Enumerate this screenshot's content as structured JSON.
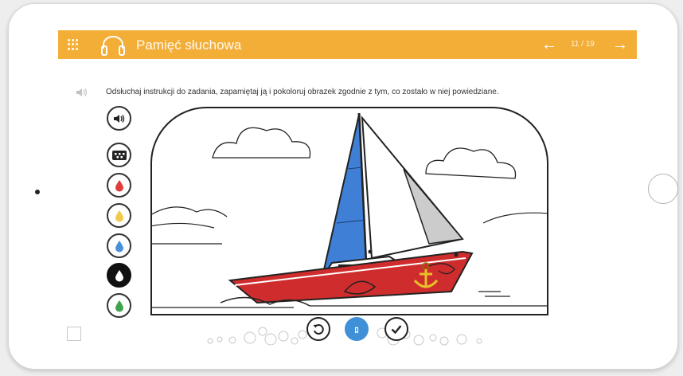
{
  "app": {
    "title": "Pamięć słuchowa",
    "accent_color": "#f3ae37"
  },
  "nav": {
    "counter": "11 / 19",
    "prev_icon": "arrow-left-icon",
    "next_icon": "arrow-right-icon"
  },
  "task": {
    "instruction": "Odsłuchaj instrukcji do zadania, zapamiętaj ją i pokoloruj obrazek zgodnie z tym, co zostało w niej powiedziane."
  },
  "tools": [
    {
      "name": "speaker",
      "icon": "speaker-icon"
    },
    {
      "name": "eraser",
      "icon": "eraser-icon"
    },
    {
      "name": "red",
      "icon": "drop-icon",
      "color": "#e03c3c"
    },
    {
      "name": "yellow",
      "icon": "drop-icon",
      "color": "#f2c94c"
    },
    {
      "name": "blue",
      "icon": "drop-icon",
      "color": "#4a90d9"
    },
    {
      "name": "black",
      "icon": "drop-icon",
      "color": "#111111",
      "selected": true
    },
    {
      "name": "green",
      "icon": "drop-icon",
      "color": "#3fa34d"
    }
  ],
  "picture_colors": {
    "sail_main": "#3f7fd6",
    "hull": "#cf2d2d",
    "sail_jib": "#cccccc",
    "anchor": "#e8c02a"
  },
  "bottom": {
    "undo_icon": "undo-icon",
    "hint_label": "ﾛ",
    "check_icon": "check-icon",
    "hint_color": "#3f90d6"
  }
}
